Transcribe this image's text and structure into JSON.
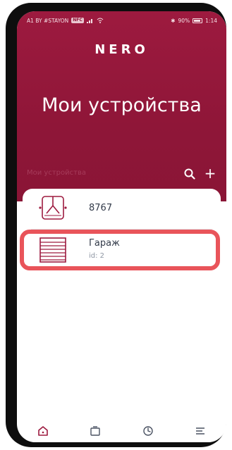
{
  "status_bar": {
    "carrier": "A1 BY #STAYON",
    "carrier_badge": "NFC",
    "battery": "90%",
    "time": "1:14"
  },
  "header": {
    "logo": "NERO",
    "title": "Мои устройства"
  },
  "subbar": {
    "label": "Мои устройства",
    "add": "+"
  },
  "devices": [
    {
      "name": "8767",
      "icon": "gate-device-icon"
    },
    {
      "name": "Гараж",
      "id_text": "id: 2",
      "icon": "garage-door-icon"
    }
  ],
  "nav": {
    "items": [
      "home-icon",
      "devices-icon",
      "clock-icon",
      "menu-icon"
    ],
    "active": "home-icon"
  },
  "colors": {
    "brand": "#8f1638",
    "highlight": "#e9545a"
  }
}
